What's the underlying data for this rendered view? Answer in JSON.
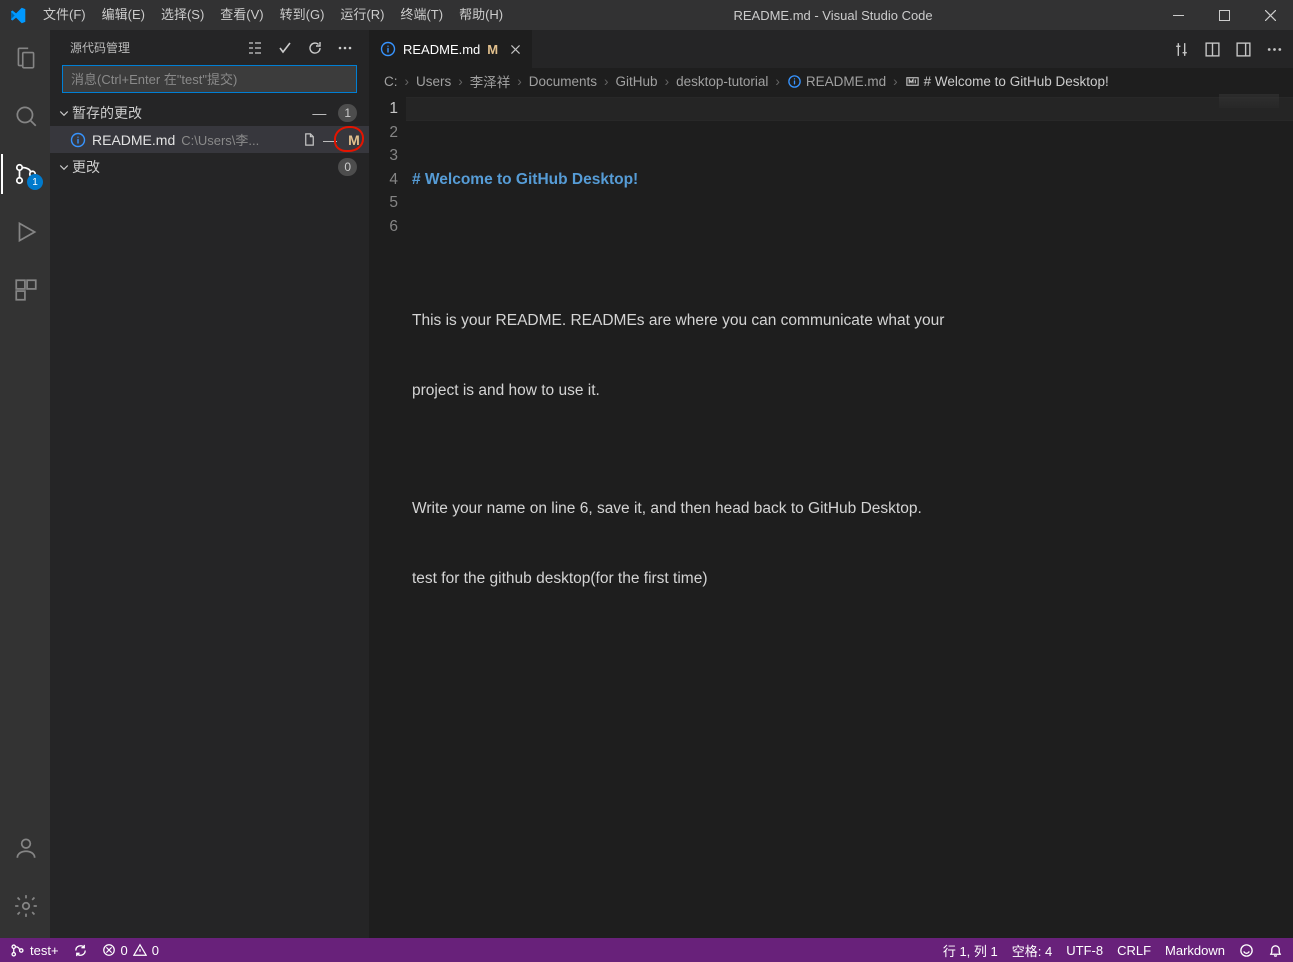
{
  "app": {
    "title": "README.md - Visual Studio Code"
  },
  "menu": [
    "文件(F)",
    "编辑(E)",
    "选择(S)",
    "查看(V)",
    "转到(G)",
    "运行(R)",
    "终端(T)",
    "帮助(H)"
  ],
  "activity": {
    "scm_badge": "1"
  },
  "scm": {
    "title": "源代码管理",
    "commit_placeholder": "消息(Ctrl+Enter 在\"test\"提交)",
    "staged_label": "暂存的更改",
    "staged_count": "1",
    "changes_label": "更改",
    "changes_count": "0",
    "file": {
      "name": "README.md",
      "path": "C:\\Users\\李...",
      "status": "M"
    }
  },
  "tab": {
    "name": "README.md",
    "modified": "M"
  },
  "breadcrumbs": [
    "C:",
    "Users",
    "李泽祥",
    "Documents",
    "GitHub",
    "desktop-tutorial",
    "README.md",
    "# Welcome to GitHub Desktop!"
  ],
  "editor": {
    "lines": [
      "1",
      "2",
      "3",
      "4",
      "5",
      "6"
    ],
    "l1": "# Welcome to GitHub Desktop!",
    "l3a": "This is your README. READMEs are where you can communicate what your",
    "l3b": "project is and how to use it.",
    "l5": "Write your name on line 6, save it, and then head back to GitHub Desktop.",
    "l6": "test for the github desktop(for the first time)"
  },
  "status": {
    "branch": "test+",
    "errors": "0",
    "warnings": "0",
    "cursor": "行 1, 列 1",
    "spaces": "空格: 4",
    "encoding": "UTF-8",
    "eol": "CRLF",
    "lang": "Markdown"
  }
}
